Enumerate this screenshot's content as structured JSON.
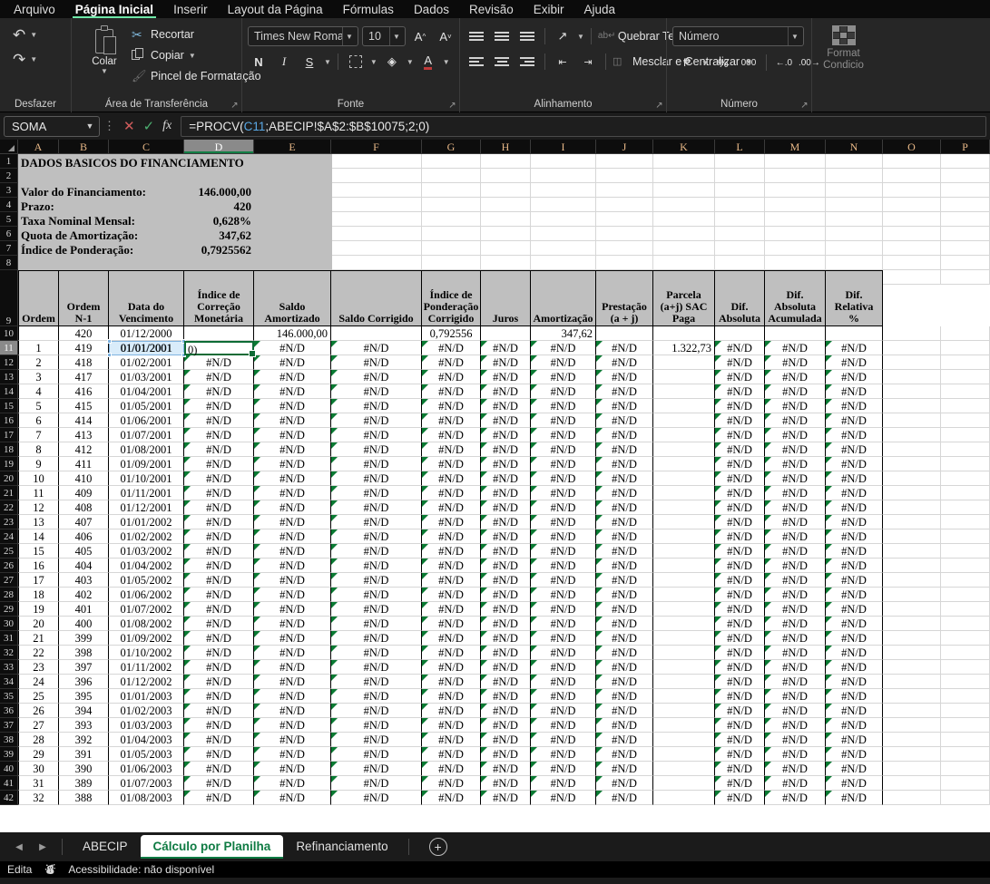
{
  "ribbon": {
    "tabs": [
      {
        "label": "Arquivo",
        "active": false
      },
      {
        "label": "Página Inicial",
        "active": true
      },
      {
        "label": "Inserir",
        "active": false
      },
      {
        "label": "Layout da Página",
        "active": false
      },
      {
        "label": "Fórmulas",
        "active": false
      },
      {
        "label": "Dados",
        "active": false
      },
      {
        "label": "Revisão",
        "active": false
      },
      {
        "label": "Exibir",
        "active": false
      },
      {
        "label": "Ajuda",
        "active": false
      }
    ],
    "groups": {
      "undo": {
        "title": "Desfazer",
        "undo_icon": "undo-icon",
        "redo_icon": "redo-icon"
      },
      "clipboard": {
        "title": "Área de Transferência",
        "paste_label": "Colar",
        "cut_label": "Recortar",
        "copy_label": "Copiar",
        "format_painter_label": "Pincel de Formatação"
      },
      "font": {
        "title": "Fonte",
        "font_name": "Times New Roman",
        "font_size": "10",
        "grow_label": "A",
        "shrink_label": "A",
        "bold_label": "N",
        "italic_label": "I",
        "underline_label": "S"
      },
      "alignment": {
        "title": "Alinhamento",
        "wrap_label": "Quebrar Texto Automaticamente",
        "merge_label": "Mesclar e Centralizar"
      },
      "number": {
        "title": "Número",
        "format_value": "Número",
        "percent_label": "%",
        "thousands_label": "000"
      },
      "styles": {
        "cond_format_line1": "Format",
        "cond_format_line2": "Condicio"
      }
    }
  },
  "formula_bar": {
    "name_box": "SOMA",
    "cancel_icon": "cancel-icon",
    "confirm_icon": "confirm-icon",
    "fx_label": "fx",
    "formula_prefix": "=PROCV(",
    "formula_ref": "C11",
    "formula_suffix": ";ABECIP!$A$2:$B$10075;2;0)"
  },
  "grid": {
    "columns": [
      "A",
      "B",
      "C",
      "D",
      "E",
      "F",
      "G",
      "H",
      "I",
      "J",
      "K",
      "L",
      "M",
      "N",
      "O",
      "P"
    ],
    "selected_column": "D",
    "selected_row": "11",
    "active_cell_value": "0)",
    "reference_cell_value": "01/01/2001",
    "summary_block": {
      "title": "DADOS BASICOS DO FINANCIAMENTO",
      "rows": [
        {
          "label": "Valor do Financiamento:",
          "value": "146.000,00"
        },
        {
          "label": "Prazo:",
          "value": "420"
        },
        {
          "label": "Taxa Nominal Mensal:",
          "value": "0,628%"
        },
        {
          "label": "Quota de Amortização:",
          "value": "347,62"
        },
        {
          "label": "Índice de Ponderação:",
          "value": "0,7925562"
        }
      ]
    },
    "table_headers": [
      "Ordem",
      "Ordem\nN-1",
      "Data do\nVencimento",
      "Índice de\nCorreção\nMonetária",
      "Saldo\nAmortizado",
      "Saldo Corrigido",
      "Índice de\nPonderação\nCorrigido",
      "Juros",
      "Amortização",
      "Prestação\n(a + j)",
      "Parcela\n(a+j) SAC\nPaga",
      "Dif.\nAbsoluta",
      "Dif.\nAbsoluta\nAcumulada",
      "Dif.\nRelativa\n%"
    ],
    "na_text": "#N/D",
    "row10": {
      "ordem": "",
      "ordem_n1": "420",
      "data": "01/12/2000",
      "indice_corr": "",
      "saldo_amort": "146.000,00",
      "saldo_corr": "",
      "indice_pond": "0,792556",
      "juros": "",
      "amortizacao": "347,62",
      "prestacao": "",
      "parcela": "",
      "dif_abs": "",
      "dif_acum": "",
      "dif_rel": ""
    },
    "row11_parcela": "1.322,73",
    "data_rows": [
      {
        "n": "11",
        "ordem": "1",
        "ordem_n1": "419",
        "data": "01/01/2001"
      },
      {
        "n": "12",
        "ordem": "2",
        "ordem_n1": "418",
        "data": "01/02/2001"
      },
      {
        "n": "13",
        "ordem": "3",
        "ordem_n1": "417",
        "data": "01/03/2001"
      },
      {
        "n": "14",
        "ordem": "4",
        "ordem_n1": "416",
        "data": "01/04/2001"
      },
      {
        "n": "15",
        "ordem": "5",
        "ordem_n1": "415",
        "data": "01/05/2001"
      },
      {
        "n": "16",
        "ordem": "6",
        "ordem_n1": "414",
        "data": "01/06/2001"
      },
      {
        "n": "17",
        "ordem": "7",
        "ordem_n1": "413",
        "data": "01/07/2001"
      },
      {
        "n": "18",
        "ordem": "8",
        "ordem_n1": "412",
        "data": "01/08/2001"
      },
      {
        "n": "19",
        "ordem": "9",
        "ordem_n1": "411",
        "data": "01/09/2001"
      },
      {
        "n": "20",
        "ordem": "10",
        "ordem_n1": "410",
        "data": "01/10/2001"
      },
      {
        "n": "21",
        "ordem": "11",
        "ordem_n1": "409",
        "data": "01/11/2001"
      },
      {
        "n": "22",
        "ordem": "12",
        "ordem_n1": "408",
        "data": "01/12/2001"
      },
      {
        "n": "23",
        "ordem": "13",
        "ordem_n1": "407",
        "data": "01/01/2002"
      },
      {
        "n": "24",
        "ordem": "14",
        "ordem_n1": "406",
        "data": "01/02/2002"
      },
      {
        "n": "25",
        "ordem": "15",
        "ordem_n1": "405",
        "data": "01/03/2002"
      },
      {
        "n": "26",
        "ordem": "16",
        "ordem_n1": "404",
        "data": "01/04/2002"
      },
      {
        "n": "27",
        "ordem": "17",
        "ordem_n1": "403",
        "data": "01/05/2002"
      },
      {
        "n": "28",
        "ordem": "18",
        "ordem_n1": "402",
        "data": "01/06/2002"
      },
      {
        "n": "29",
        "ordem": "19",
        "ordem_n1": "401",
        "data": "01/07/2002"
      },
      {
        "n": "30",
        "ordem": "20",
        "ordem_n1": "400",
        "data": "01/08/2002"
      },
      {
        "n": "31",
        "ordem": "21",
        "ordem_n1": "399",
        "data": "01/09/2002"
      },
      {
        "n": "32",
        "ordem": "22",
        "ordem_n1": "398",
        "data": "01/10/2002"
      },
      {
        "n": "33",
        "ordem": "23",
        "ordem_n1": "397",
        "data": "01/11/2002"
      },
      {
        "n": "34",
        "ordem": "24",
        "ordem_n1": "396",
        "data": "01/12/2002"
      },
      {
        "n": "35",
        "ordem": "25",
        "ordem_n1": "395",
        "data": "01/01/2003"
      },
      {
        "n": "36",
        "ordem": "26",
        "ordem_n1": "394",
        "data": "01/02/2003"
      },
      {
        "n": "37",
        "ordem": "27",
        "ordem_n1": "393",
        "data": "01/03/2003"
      },
      {
        "n": "38",
        "ordem": "28",
        "ordem_n1": "392",
        "data": "01/04/2003"
      },
      {
        "n": "39",
        "ordem": "29",
        "ordem_n1": "391",
        "data": "01/05/2003"
      },
      {
        "n": "40",
        "ordem": "30",
        "ordem_n1": "390",
        "data": "01/06/2003"
      },
      {
        "n": "41",
        "ordem": "31",
        "ordem_n1": "389",
        "data": "01/07/2003"
      },
      {
        "n": "42",
        "ordem": "32",
        "ordem_n1": "388",
        "data": "01/08/2003"
      }
    ],
    "empty_rows_top": [
      "1",
      "2",
      "3",
      "4",
      "5",
      "6",
      "7",
      "8"
    ]
  },
  "sheet_tabs": {
    "prev_icon": "prev-sheet-icon",
    "next_icon": "next-sheet-icon",
    "tabs": [
      {
        "label": "ABECIP",
        "active": false
      },
      {
        "label": "Cálculo por Planilha",
        "active": true
      },
      {
        "label": "Refinanciamento",
        "active": false
      }
    ],
    "add_label": "+"
  },
  "status_bar": {
    "mode": "Edita",
    "accessibility": "Acessibilidade: não disponível"
  },
  "colors": {
    "accent_green": "#0f7b43",
    "header_gray": "#bfbfbf",
    "ribbon_bg": "#262626",
    "error_flag": "#0a7a33"
  }
}
